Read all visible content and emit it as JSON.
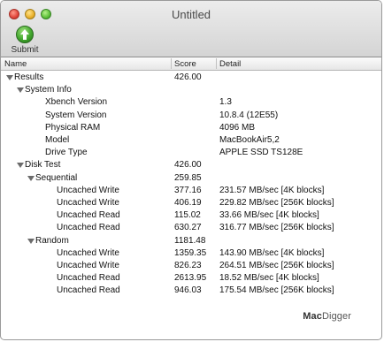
{
  "window": {
    "title": "Untitled"
  },
  "toolbar": {
    "submit_label": "Submit"
  },
  "columns": {
    "name": "Name",
    "score": "Score",
    "detail": "Detail"
  },
  "rows": [
    {
      "name": "Results",
      "score": "426.00",
      "detail": "",
      "level": 0,
      "expandable": true
    },
    {
      "name": "System Info",
      "score": "",
      "detail": "",
      "level": 1,
      "expandable": true
    },
    {
      "name": "Xbench Version",
      "score": "",
      "detail": "1.3",
      "level": 2,
      "expandable": false
    },
    {
      "name": "System Version",
      "score": "",
      "detail": "10.8.4 (12E55)",
      "level": 2,
      "expandable": false
    },
    {
      "name": "Physical RAM",
      "score": "",
      "detail": "4096 MB",
      "level": 2,
      "expandable": false
    },
    {
      "name": "Model",
      "score": "",
      "detail": "MacBookAir5,2",
      "level": 2,
      "expandable": false
    },
    {
      "name": "Drive Type",
      "score": "",
      "detail": "APPLE SSD TS128E",
      "level": 2,
      "expandable": false
    },
    {
      "name": "Disk Test",
      "score": "426.00",
      "detail": "",
      "level": 1,
      "expandable": true
    },
    {
      "name": "Sequential",
      "score": "259.85",
      "detail": "",
      "level": 2,
      "expandable": true
    },
    {
      "name": "Uncached Write",
      "score": "377.16",
      "detail": "231.57 MB/sec [4K blocks]",
      "level": 3,
      "expandable": false
    },
    {
      "name": "Uncached Write",
      "score": "406.19",
      "detail": "229.82 MB/sec [256K blocks]",
      "level": 3,
      "expandable": false
    },
    {
      "name": "Uncached Read",
      "score": "115.02",
      "detail": "33.66 MB/sec [4K blocks]",
      "level": 3,
      "expandable": false
    },
    {
      "name": "Uncached Read",
      "score": "630.27",
      "detail": "316.77 MB/sec [256K blocks]",
      "level": 3,
      "expandable": false
    },
    {
      "name": "Random",
      "score": "1181.48",
      "detail": "",
      "level": 2,
      "expandable": true
    },
    {
      "name": "Uncached Write",
      "score": "1359.35",
      "detail": "143.90 MB/sec [4K blocks]",
      "level": 3,
      "expandable": false
    },
    {
      "name": "Uncached Write",
      "score": "826.23",
      "detail": "264.51 MB/sec [256K blocks]",
      "level": 3,
      "expandable": false
    },
    {
      "name": "Uncached Read",
      "score": "2613.95",
      "detail": "18.52 MB/sec [4K blocks]",
      "level": 3,
      "expandable": false
    },
    {
      "name": "Uncached Read",
      "score": "946.03",
      "detail": "175.54 MB/sec [256K blocks]",
      "level": 3,
      "expandable": false
    }
  ],
  "watermark": {
    "part1": "Mac",
    "part2": "Digger"
  }
}
